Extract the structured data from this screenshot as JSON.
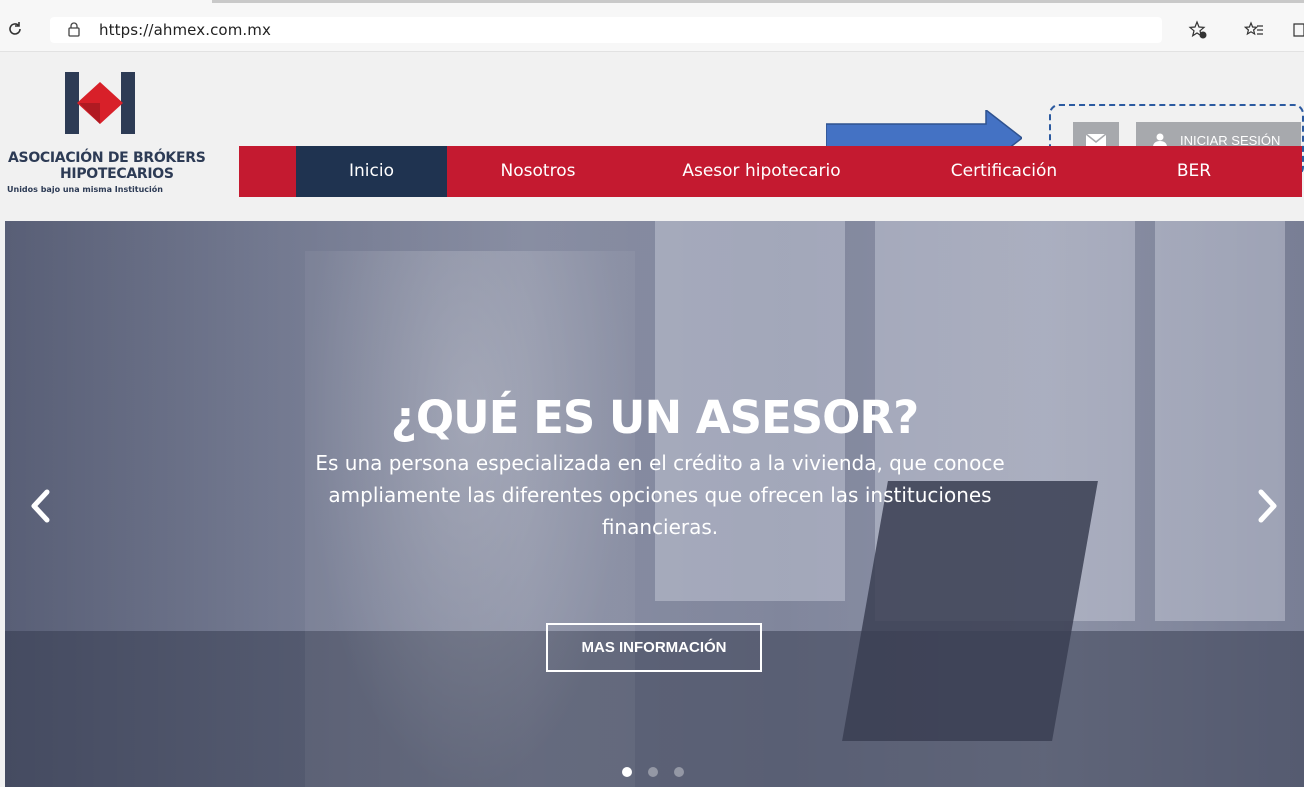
{
  "browser": {
    "url": "https://ahmex.com.mx"
  },
  "header": {
    "brand_line1": "ASOCIACIÓN DE BRÓKERS",
    "brand_line2": "HIPOTECARIOS",
    "brand_tagline": "Unidos bajo una misma Institución",
    "login_label": "INICIAR SESIÓN"
  },
  "nav": {
    "items": [
      {
        "label": "Inicio",
        "active": true
      },
      {
        "label": "Nosotros"
      },
      {
        "label": "Asesor hipotecario"
      },
      {
        "label": "Certificación"
      },
      {
        "label": "BER"
      }
    ]
  },
  "hero": {
    "title": "¿QUÉ ES UN ASESOR?",
    "description": "Es una persona especializada en el crédito a la vivienda, que conoce ampliamente las diferentes opciones que ofrecen las instituciones financieras.",
    "cta_label": "MAS INFORMACIÓN",
    "slide_count": 3,
    "active_slide": 1
  },
  "colors": {
    "nav_red": "#c41a30",
    "nav_active": "#1f3350",
    "annotation_blue": "#4472c4"
  },
  "icons": [
    "reload-icon",
    "lock-icon",
    "favorite-add-icon",
    "favorites-icon",
    "mail-icon",
    "user-icon",
    "chevron-left-icon",
    "chevron-right-icon",
    "annotation-arrow"
  ]
}
